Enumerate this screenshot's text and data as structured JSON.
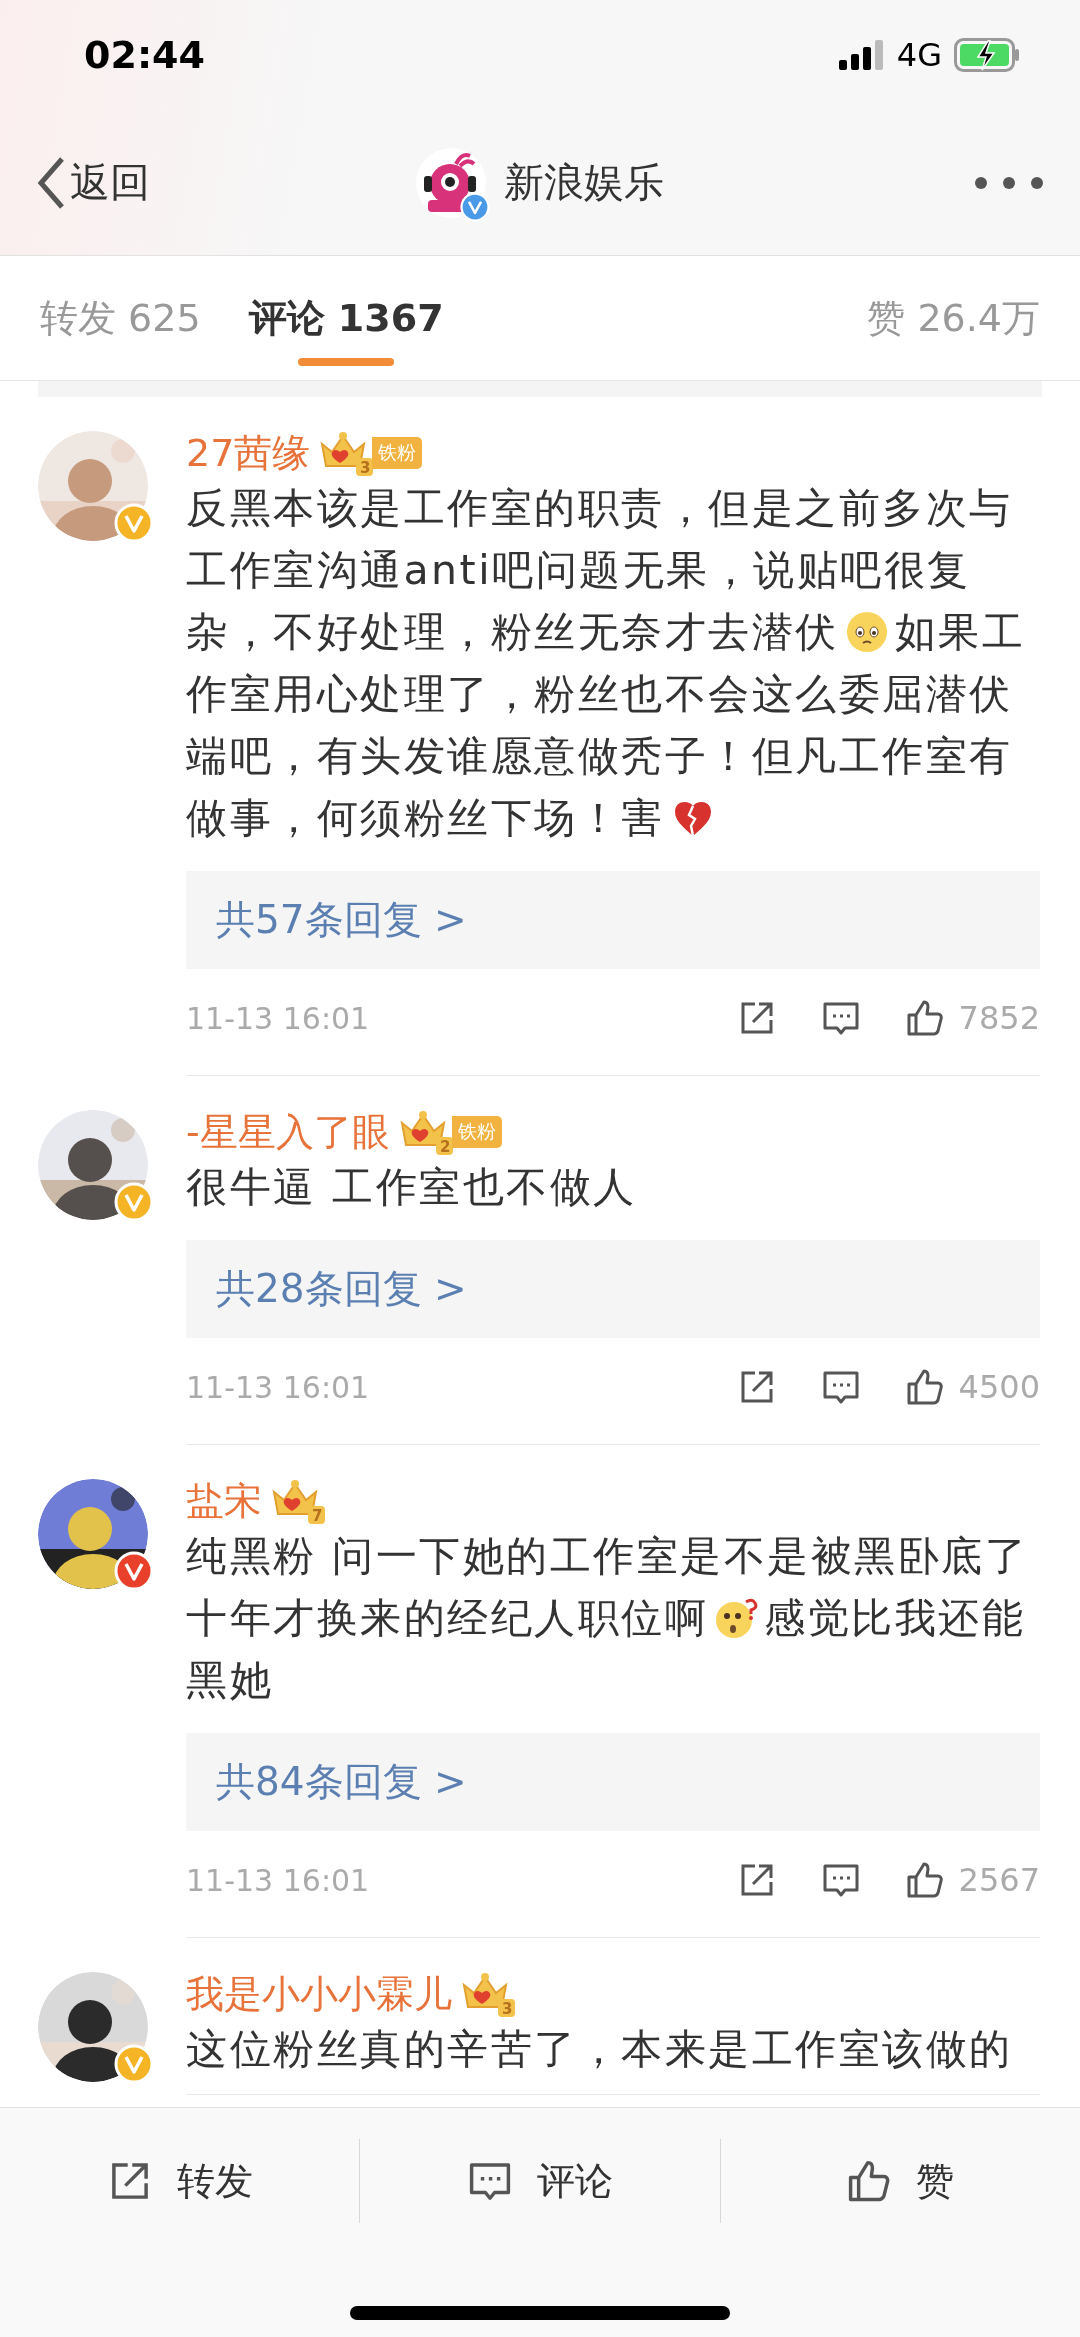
{
  "status_bar": {
    "time": "02:44",
    "network": "4G"
  },
  "nav": {
    "back": "返回",
    "title": "新浪娱乐"
  },
  "tabs": [
    {
      "label": "转发",
      "count": "625",
      "selected": false
    },
    {
      "label": "评论",
      "count": "1367",
      "selected": true
    },
    {
      "label": "赞",
      "count": "26.4万",
      "selected": false
    }
  ],
  "comments": [
    {
      "name": "27茜缘",
      "crown_level": "3",
      "fan_label": "铁粉",
      "verified": {
        "color": "#f5b326"
      },
      "body": [
        {
          "kind": "text",
          "text": "反黑本该是工作室的职责，但是之前多次与工作室沟通anti吧问题无果，说贴吧很复杂，不好处理，粉丝无奈才去潜伏"
        },
        {
          "kind": "sad-face"
        },
        {
          "kind": "text",
          "text": "如果工作室用心处理了，粉丝也不会这么委屈潜伏端吧，有头发谁愿意做秃子！但凡工作室有做事，何须粉丝下场！害"
        },
        {
          "kind": "broken-heart"
        }
      ],
      "replies": "共57条回复 >",
      "time": "11-13 16:01",
      "likes": "7852"
    },
    {
      "name": "-星星入了眼",
      "crown_level": "2",
      "fan_label": "铁粉",
      "verified": {
        "color": "#f5b326"
      },
      "body": [
        {
          "kind": "text",
          "text": "很牛逼 工作室也不做人"
        }
      ],
      "replies": "共28条回复 >",
      "time": "11-13 16:01",
      "likes": "4500"
    },
    {
      "name": "盐宋",
      "crown_level": "7",
      "verified": {
        "color": "#e8402b"
      },
      "body": [
        {
          "kind": "text",
          "text": "纯黑粉 问一下她的工作室是不是被黑卧底了十年才换来的经纪人职位啊"
        },
        {
          "kind": "puzzled-face"
        },
        {
          "kind": "text",
          "text": "感觉比我还能黑她"
        }
      ],
      "replies": "共84条回复 >",
      "time": "11-13 16:01",
      "likes": "2567"
    },
    {
      "name": "我是小小小霖儿",
      "crown_level": "3",
      "verified": {
        "color": "#f5b326"
      },
      "body": [
        {
          "kind": "text",
          "text": "这位粉丝真的辛苦了，本来是工作室该做的"
        }
      ]
    }
  ],
  "bottom_bar": [
    {
      "label": "转发",
      "kind": "share"
    },
    {
      "label": "评论",
      "kind": "comment"
    },
    {
      "label": "赞",
      "kind": "like"
    }
  ]
}
